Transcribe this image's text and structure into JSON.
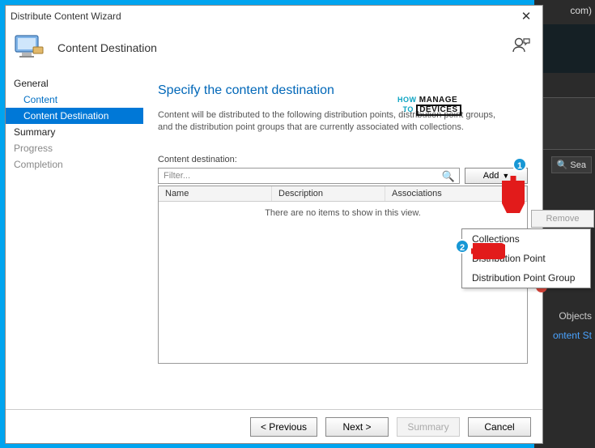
{
  "bg": {
    "com": "com)",
    "search": "Sea",
    "objects": "Objects",
    "link": "ontent St"
  },
  "titlebar": {
    "title": "Distribute Content Wizard"
  },
  "header": {
    "banner": "Content Destination"
  },
  "nav": {
    "general": "General",
    "content": "Content",
    "content_destination": "Content Destination",
    "summary": "Summary",
    "progress": "Progress",
    "completion": "Completion"
  },
  "page": {
    "heading": "Specify the content destination",
    "intro": "Content will be distributed to the following distribution points, distribution point groups, and the distribution point groups that are currently associated with collections.",
    "field_label": "Content destination:",
    "filter_placeholder": "Filter...",
    "add_label": "Add",
    "cols": {
      "name": "Name",
      "description": "Description",
      "associations": "Associations"
    },
    "empty": "There are no items to show in this view.",
    "side": {
      "remove": "Remove"
    }
  },
  "menu": {
    "collections": "Collections",
    "dp": "Distribution Point",
    "dpg": "Distribution Point Group"
  },
  "footer": {
    "previous": "< Previous",
    "next": "Next >",
    "summary": "Summary",
    "cancel": "Cancel"
  },
  "watermark": {
    "how": "HOW",
    "to": "TO",
    "manage": "MANAGE",
    "devices": "DEVICES"
  }
}
